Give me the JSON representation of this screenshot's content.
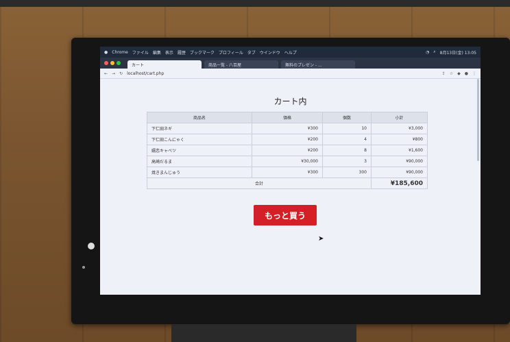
{
  "browser": {
    "menu": [
      "Chrome",
      "ファイル",
      "編集",
      "表示",
      "履歴",
      "ブックマーク",
      "プロフィール",
      "タブ",
      "ウインドウ",
      "ヘルプ"
    ],
    "clock": "8月13日(金) 13:05",
    "tabs": [
      {
        "label": "カート",
        "active": true
      },
      {
        "label": "商品一覧 - 八百屋",
        "active": false
      },
      {
        "label": "無料のプレゼン - ...",
        "active": false
      }
    ],
    "url": "localhost/cart.php"
  },
  "page": {
    "title": "カート内",
    "headers": [
      "商品名",
      "価格",
      "個数",
      "小計"
    ],
    "rows": [
      {
        "name": "下仁田ネギ",
        "price": "¥300",
        "qty": "10",
        "subtotal": "¥3,000"
      },
      {
        "name": "下仁田こんにゃく",
        "price": "¥200",
        "qty": "4",
        "subtotal": "¥800"
      },
      {
        "name": "嬬恋キャベツ",
        "price": "¥200",
        "qty": "8",
        "subtotal": "¥1,600"
      },
      {
        "name": "高崎だるま",
        "price": "¥30,000",
        "qty": "3",
        "subtotal": "¥90,000"
      },
      {
        "name": "焼きまんじゅう",
        "price": "¥300",
        "qty": "300",
        "subtotal": "¥90,000"
      }
    ],
    "total_label": "合計",
    "total_value": "¥185,600",
    "more_button": "もっと買う"
  },
  "colors": {
    "button": "#d41f26",
    "screen_bg": "#eef2f8"
  }
}
